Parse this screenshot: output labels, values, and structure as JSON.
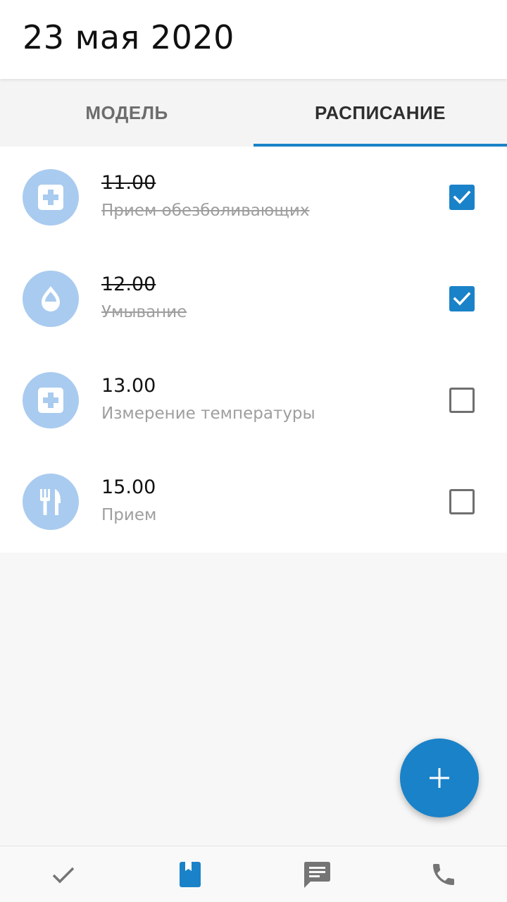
{
  "header": {
    "title": "23 мая 2020"
  },
  "tabs": [
    {
      "label": "МОДЕЛЬ",
      "active": false
    },
    {
      "label": "РАСПИСАНИЕ",
      "active": true
    }
  ],
  "schedule": [
    {
      "time": "11.00",
      "title": "Прием обезболивающих",
      "icon": "medical-cross-icon",
      "done": true
    },
    {
      "time": "12.00",
      "title": "Умывание",
      "icon": "water-drop-icon",
      "done": true
    },
    {
      "time": "13.00",
      "title": "Измерение температуры",
      "icon": "medical-cross-icon",
      "done": false
    },
    {
      "time": "15.00",
      "title": "Прием",
      "icon": "fork-knife-icon",
      "done": false
    }
  ],
  "fab": {
    "icon": "plus-icon"
  },
  "bottom_nav": [
    {
      "icon": "checkmark-icon",
      "active": false
    },
    {
      "icon": "bookmark-book-icon",
      "active": true
    },
    {
      "icon": "chat-message-icon",
      "active": false
    },
    {
      "icon": "phone-icon",
      "active": false
    }
  ],
  "colors": {
    "accent": "#1a82c8",
    "avatar_bg": "#a9cbef",
    "muted_text": "#9e9e9e",
    "nav_inactive": "#757575"
  }
}
